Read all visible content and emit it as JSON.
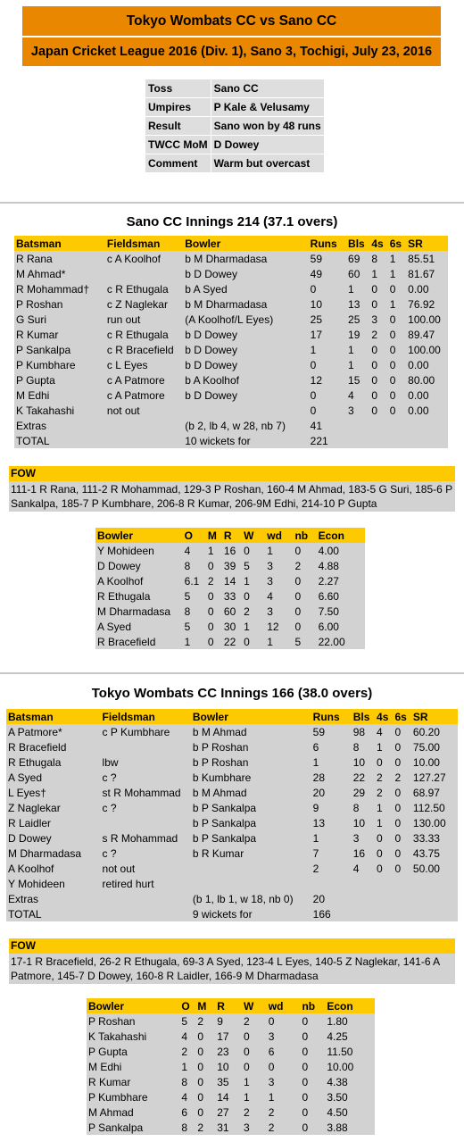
{
  "header": {
    "title": "Tokyo Wombats CC vs Sano CC",
    "subtitle": "Japan Cricket League 2016 (Div. 1), Sano 3, Tochigi, July 23, 2016"
  },
  "match_info": [
    {
      "label": "Toss",
      "value": "Sano CC"
    },
    {
      "label": "Umpires",
      "value": "P Kale & Velusamy"
    },
    {
      "label": "Result",
      "value": "Sano won by 48 runs"
    },
    {
      "label": "TWCC MoM",
      "value": "D Dowey"
    },
    {
      "label": "Comment",
      "value": "Warm but overcast"
    }
  ],
  "batting_headers": [
    "Batsman",
    "Fieldsman",
    "Bowler",
    "Runs",
    "Bls",
    "4s",
    "6s",
    "SR"
  ],
  "bowling_headers": [
    "Bowler",
    "O",
    "M",
    "R",
    "W",
    "wd",
    "nb",
    "Econ"
  ],
  "fow_label": "FOW",
  "innings": [
    {
      "title": "Sano CC Innings 214 (37.1 overs)",
      "batting": [
        [
          "R Rana",
          "c A Koolhof",
          "b M Dharmadasa",
          "59",
          "69",
          "8",
          "1",
          "85.51"
        ],
        [
          "M Ahmad*",
          "",
          "b D Dowey",
          "49",
          "60",
          "1",
          "1",
          "81.67"
        ],
        [
          "R Mohammad†",
          "c R Ethugala",
          "b A Syed",
          "0",
          "1",
          "0",
          "0",
          "0.00"
        ],
        [
          "P Roshan",
          "c Z Naglekar",
          "b M Dharmadasa",
          "10",
          "13",
          "0",
          "1",
          "76.92"
        ],
        [
          "G Suri",
          "run out",
          "(A Koolhof/L Eyes)",
          "25",
          "25",
          "3",
          "0",
          "100.00"
        ],
        [
          "R Kumar",
          "c R Ethugala",
          "b D Dowey",
          "17",
          "19",
          "2",
          "0",
          "89.47"
        ],
        [
          "P Sankalpa",
          "c R Bracefield",
          "b D Dowey",
          "1",
          "1",
          "0",
          "0",
          "100.00"
        ],
        [
          "P Kumbhare",
          "c L Eyes",
          "b D Dowey",
          "0",
          "1",
          "0",
          "0",
          "0.00"
        ],
        [
          "P Gupta",
          "c A Patmore",
          "b A Koolhof",
          "12",
          "15",
          "0",
          "0",
          "80.00"
        ],
        [
          "M Edhi",
          "c A Patmore",
          "b D Dowey",
          "0",
          "4",
          "0",
          "0",
          "0.00"
        ],
        [
          "K Takahashi",
          "not out",
          "",
          "0",
          "3",
          "0",
          "0",
          "0.00"
        ],
        [
          "Extras",
          "",
          "(b 2, lb 4, w 28, nb 7)",
          "41",
          "",
          "",
          "",
          ""
        ],
        [
          "TOTAL",
          "",
          "10 wickets for",
          "221",
          "",
          "",
          "",
          ""
        ]
      ],
      "fow": "111-1 R Rana, 111-2 R Mohammad, 129-3 P Roshan, 160-4 M Ahmad, 183-5 G Suri, 185-6 P Sankalpa, 185-7 P Kumbhare, 206-8 R Kumar, 206-9M Edhi, 214-10 P Gupta",
      "bowling": [
        [
          "Y Mohideen",
          "4",
          "1",
          "16",
          "0",
          "1",
          "0",
          "4.00"
        ],
        [
          "D Dowey",
          "8",
          "0",
          "39",
          "5",
          "3",
          "2",
          "4.88"
        ],
        [
          "A Koolhof",
          "6.1",
          "2",
          "14",
          "1",
          "3",
          "0",
          "2.27"
        ],
        [
          "R Ethugala",
          "5",
          "0",
          "33",
          "0",
          "4",
          "0",
          "6.60"
        ],
        [
          "M Dharmadasa",
          "8",
          "0",
          "60",
          "2",
          "3",
          "0",
          "7.50"
        ],
        [
          "A Syed",
          "5",
          "0",
          "30",
          "1",
          "12",
          "0",
          "6.00"
        ],
        [
          "R Bracefield",
          "1",
          "0",
          "22",
          "0",
          "1",
          "5",
          "22.00"
        ]
      ]
    },
    {
      "title": "Tokyo Wombats CC Innings 166 (38.0 overs)",
      "batting": [
        [
          "A Patmore*",
          "c P Kumbhare",
          "b M Ahmad",
          "59",
          "98",
          "4",
          "0",
          "60.20"
        ],
        [
          "R Bracefield",
          "",
          "b P Roshan",
          "6",
          "8",
          "1",
          "0",
          "75.00"
        ],
        [
          "R Ethugala",
          "lbw",
          "b P Roshan",
          "1",
          "10",
          "0",
          "0",
          "10.00"
        ],
        [
          "A Syed",
          "c ?",
          "b Kumbhare",
          "28",
          "22",
          "2",
          "2",
          "127.27"
        ],
        [
          "L Eyes†",
          "st R Mohammad",
          "b M Ahmad",
          "20",
          "29",
          "2",
          "0",
          "68.97"
        ],
        [
          "Z Naglekar",
          "c ?",
          "b P Sankalpa",
          "9",
          "8",
          "1",
          "0",
          "112.50"
        ],
        [
          "R Laidler",
          "",
          "b P Sankalpa",
          "13",
          "10",
          "1",
          "0",
          "130.00"
        ],
        [
          "D Dowey",
          "s R Mohammad",
          "b P Sankalpa",
          "1",
          "3",
          "0",
          "0",
          "33.33"
        ],
        [
          "M Dharmadasa",
          "c ?",
          "b R Kumar",
          "7",
          "16",
          "0",
          "0",
          "43.75"
        ],
        [
          "A Koolhof",
          "not out",
          "",
          "2",
          "4",
          "0",
          "0",
          "50.00"
        ],
        [
          "Y Mohideen",
          "retired hurt",
          "",
          "",
          "",
          "",
          "",
          ""
        ],
        [
          "Extras",
          "",
          "(b 1, lb 1, w 18, nb 0)",
          "20",
          "",
          "",
          "",
          ""
        ],
        [
          "TOTAL",
          "",
          "9 wickets for",
          "166",
          "",
          "",
          "",
          ""
        ]
      ],
      "fow": "17-1 R Bracefield, 26-2 R Ethugala, 69-3 A Syed, 123-4 L Eyes, 140-5 Z Naglekar, 141-6 A Patmore, 145-7 D Dowey, 160-8 R Laidler, 166-9 M Dharmadasa",
      "bowling": [
        [
          "P Roshan",
          "5",
          "2",
          "9",
          "2",
          "0",
          "0",
          "1.80"
        ],
        [
          "K Takahashi",
          "4",
          "0",
          "17",
          "0",
          "3",
          "0",
          "4.25"
        ],
        [
          "P Gupta",
          "2",
          "0",
          "23",
          "0",
          "6",
          "0",
          "11.50"
        ],
        [
          "M Edhi",
          "1",
          "0",
          "10",
          "0",
          "0",
          "0",
          "10.00"
        ],
        [
          "R Kumar",
          "8",
          "0",
          "35",
          "1",
          "3",
          "0",
          "4.38"
        ],
        [
          "P Kumbhare",
          "4",
          "0",
          "14",
          "1",
          "1",
          "0",
          "3.50"
        ],
        [
          "M Ahmad",
          "6",
          "0",
          "27",
          "2",
          "2",
          "0",
          "4.50"
        ],
        [
          "P Sankalpa",
          "8",
          "2",
          "31",
          "3",
          "2",
          "0",
          "3.88"
        ]
      ]
    }
  ]
}
